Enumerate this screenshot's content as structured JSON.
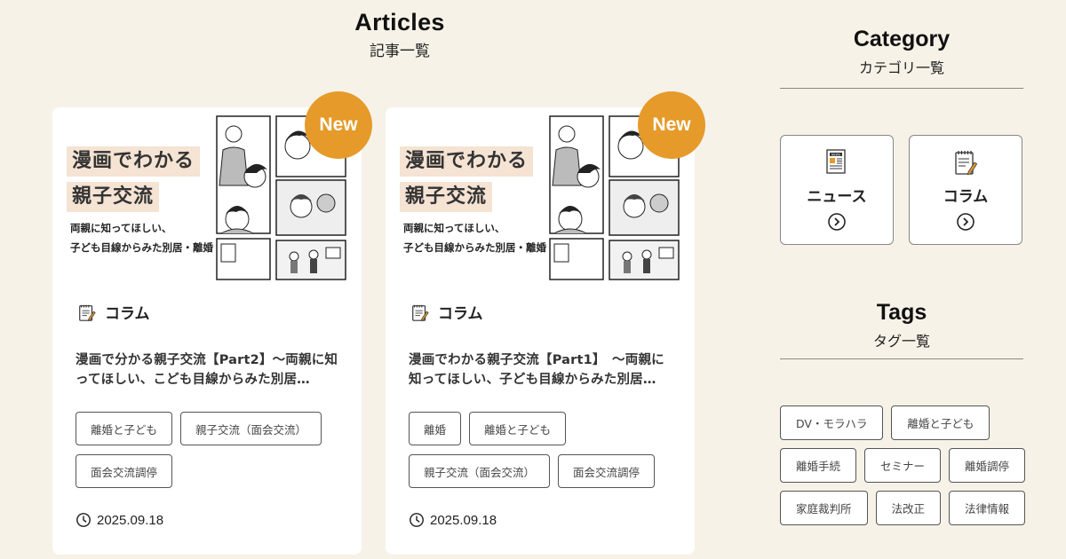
{
  "header": {
    "title_en": "Articles",
    "title_jp": "記事一覧"
  },
  "cards": [
    {
      "badge": "New",
      "thumb_title_1": "漫画でわかる",
      "thumb_title_2": "親子交流",
      "thumb_sub_1": "両親に知ってほしい、",
      "thumb_sub_2": "子ども目線からみた別居・離婚",
      "category": "コラム",
      "category_icon": "notepad-icon",
      "title": "漫画で分かる親子交流【Part2】～両親に知ってほしい、こども目線からみた別居…",
      "tags": [
        "離婚と子ども",
        "親子交流（面会交流）",
        "面会交流調停"
      ],
      "date": "2025.09.18"
    },
    {
      "badge": "New",
      "thumb_title_1": "漫画でわかる",
      "thumb_title_2": "親子交流",
      "thumb_sub_1": "両親に知ってほしい、",
      "thumb_sub_2": "子ども目線からみた別居・離婚",
      "category": "コラム",
      "category_icon": "notepad-icon",
      "title": "漫画でわかる親子交流【Part1】　～両親に知ってほしい、子ども目線からみた別居…",
      "tags": [
        "離婚",
        "離婚と子ども",
        "親子交流（面会交流）",
        "面会交流調停"
      ],
      "date": "2025.09.18"
    }
  ],
  "sidebar": {
    "category": {
      "title_en": "Category",
      "title_jp": "カテゴリ一覧",
      "items": [
        {
          "label": "ニュース",
          "icon": "newspaper-icon"
        },
        {
          "label": "コラム",
          "icon": "notepad-icon"
        }
      ]
    },
    "tags": {
      "title_en": "Tags",
      "title_jp": "タグ一覧",
      "items": [
        "DV・モラハラ",
        "離婚と子ども",
        "離婚手続",
        "セミナー",
        "離婚調停",
        "家庭裁判所",
        "法改正",
        "法律情報"
      ]
    }
  },
  "colors": {
    "background": "#f7f2e8",
    "accent": "#e59a2a",
    "highlight": "#f5e3d3"
  }
}
